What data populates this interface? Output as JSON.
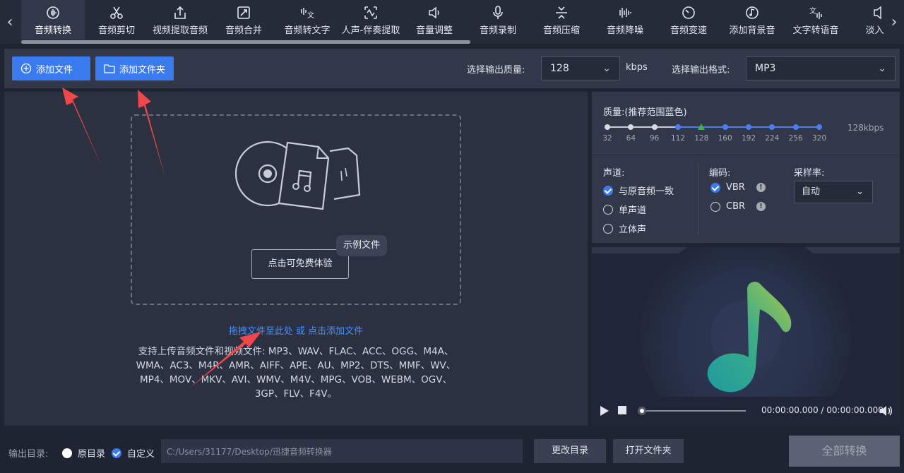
{
  "tabs": [
    {
      "label": "音频转换",
      "icon": "audio-convert-icon",
      "active": true
    },
    {
      "label": "音频剪切",
      "icon": "scissors-icon"
    },
    {
      "label": "视频提取音频",
      "icon": "extract-icon"
    },
    {
      "label": "音频合并",
      "icon": "merge-icon"
    },
    {
      "label": "音频转文字",
      "icon": "speech-to-text-icon"
    },
    {
      "label": "人声-伴奏提取",
      "icon": "vocal-separation-icon"
    },
    {
      "label": "音量调整",
      "icon": "volume-icon"
    },
    {
      "label": "音频录制",
      "icon": "microphone-icon"
    },
    {
      "label": "音频压缩",
      "icon": "compress-icon"
    },
    {
      "label": "音频降噪",
      "icon": "noise-reduce-icon"
    },
    {
      "label": "音频变速",
      "icon": "speed-icon"
    },
    {
      "label": "添加背景音",
      "icon": "background-music-icon"
    },
    {
      "label": "文字转语音",
      "icon": "text-to-speech-icon"
    },
    {
      "label": "淡入淡",
      "icon": "fade-icon"
    }
  ],
  "toolbar": {
    "add_file": "添加文件",
    "add_folder": "添加文件夹",
    "quality_label": "选择输出质量:",
    "quality_value": "128",
    "quality_unit": "kbps",
    "format_label": "选择输出格式:",
    "format_value": "MP3"
  },
  "dropzone": {
    "try_button": "点击可免费体验",
    "sample_tag": "示例文件",
    "drag_text": "拖拽文件至此处",
    "or_text": " 或 ",
    "click_add": "点击添加文件",
    "support_text": "支持上传音频文件和视频文件: MP3、WAV、FLAC、ACC、OGG、M4A、WMA、AC3、M4R、AMR、AIFF、APE、AU、MP2、DTS、MMF、WV、MP4、MOV、MKV、AVI、WMV、M4V、MPG、VOB、WEBM、OGV、3GP、FLV、F4V。"
  },
  "quality": {
    "title": "质量:(推荐范围蓝色)",
    "ticks": [
      "32",
      "64",
      "96",
      "112",
      "128",
      "160",
      "192",
      "224",
      "256",
      "320"
    ],
    "blue_from_index": 3,
    "selected_index": 4,
    "current": "128kbps"
  },
  "channel": {
    "title": "声道:",
    "options": [
      "与原音频一致",
      "单声道",
      "立体声"
    ],
    "selected": 0
  },
  "encoding": {
    "title": "编码:",
    "options": [
      "VBR",
      "CBR"
    ],
    "selected": 0
  },
  "sample_rate": {
    "title": "采样率:",
    "value": "自动"
  },
  "player": {
    "time": "00:00:00.000 / 00:00:00.000",
    "progress": 0
  },
  "bottom": {
    "output_label": "输出目录:",
    "original_dir": "原目录",
    "custom_dir": "自定义",
    "path": "C:/Users/31177/Desktop/迅捷音频转换器",
    "change_dir": "更改目录",
    "open_folder": "打开文件夹",
    "convert_all": "全部转换"
  },
  "colors": {
    "accent": "#3a7bef",
    "link": "#4c8df6",
    "selected_tick": "#3ab83a",
    "annotation": "#f0474a"
  }
}
